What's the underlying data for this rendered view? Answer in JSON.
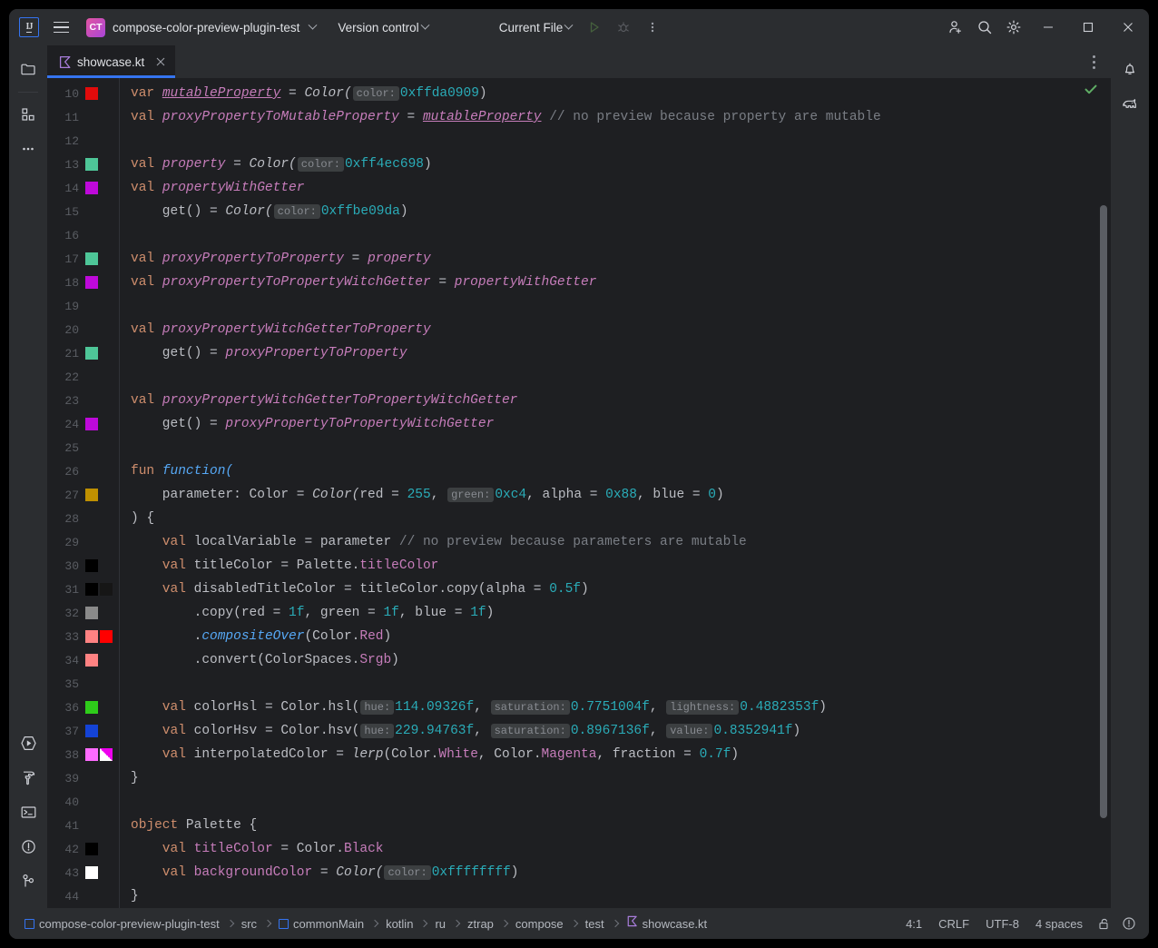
{
  "titlebar": {
    "logo_text": "IJ",
    "menu_icon": "hamburger-menu-icon",
    "project_initials": "CT",
    "project_name": "compose-color-preview-plugin-test",
    "vcs_label": "Version control",
    "run_config_label": "Current File",
    "run_icon": "run-icon",
    "debug_icon": "debug-icon",
    "more_icon": "more-vertical-icon",
    "account_icon": "add-account-icon",
    "search_icon": "search-icon",
    "settings_icon": "gear-icon",
    "minimize_icon": "minimize-icon",
    "maximize_icon": "maximize-icon",
    "close_icon": "close-icon"
  },
  "left_stripe": {
    "top": [
      {
        "name": "project-tool-window",
        "icon": "folder-icon"
      },
      {
        "name": "structure-tool-window",
        "icon": "grid-squares-icon"
      },
      {
        "name": "more-tool-windows",
        "icon": "ellipsis-icon"
      }
    ],
    "bottom": [
      {
        "name": "run-tool-window",
        "icon": "run-hex-icon"
      },
      {
        "name": "build-tool-window",
        "icon": "hammer-icon"
      },
      {
        "name": "terminal-tool-window",
        "icon": "terminal-icon"
      },
      {
        "name": "problems-tool-window",
        "icon": "exclamation-circle-icon"
      },
      {
        "name": "version-control-tool-window",
        "icon": "branch-icon"
      }
    ]
  },
  "right_stripe": [
    {
      "name": "notifications",
      "icon": "bell-icon"
    },
    {
      "name": "database",
      "icon": "elephant-icon"
    }
  ],
  "tabs": {
    "items": [
      {
        "label": "showcase.kt",
        "icon": "kotlin-file-icon",
        "active": true,
        "close_icon": "close-icon"
      }
    ],
    "options_icon": "more-vertical-icon"
  },
  "editor": {
    "inspection_status": "ok-checkmark",
    "caret_position": "4:1",
    "lines": [
      {
        "num": 10,
        "swatches": [
          "#e20b0b"
        ],
        "tokens": [
          {
            "t": "var ",
            "c": "k"
          },
          {
            "t": "mutableProperty",
            "c": "idu"
          },
          {
            "t": " = ",
            "c": "pl"
          },
          {
            "t": "Color(",
            "c": "cls"
          },
          {
            "t": "color:",
            "c": "hint"
          },
          {
            "t": "0xffda0909",
            "c": "num"
          },
          {
            "t": ")",
            "c": "pl"
          }
        ]
      },
      {
        "num": 11,
        "swatches": [],
        "tokens": [
          {
            "t": "val ",
            "c": "k"
          },
          {
            "t": "proxyPropertyToMutableProperty",
            "c": "id"
          },
          {
            "t": " = ",
            "c": "pl"
          },
          {
            "t": "mutableProperty",
            "c": "idu"
          },
          {
            "t": " // no preview because property are mutable",
            "c": "cm"
          }
        ]
      },
      {
        "num": 12,
        "swatches": [],
        "tokens": []
      },
      {
        "num": 13,
        "swatches": [
          "#4ec698"
        ],
        "tokens": [
          {
            "t": "val ",
            "c": "k"
          },
          {
            "t": "property",
            "c": "id"
          },
          {
            "t": " = ",
            "c": "pl"
          },
          {
            "t": "Color(",
            "c": "cls"
          },
          {
            "t": "color:",
            "c": "hint"
          },
          {
            "t": "0xff4ec698",
            "c": "num"
          },
          {
            "t": ")",
            "c": "pl"
          }
        ]
      },
      {
        "num": 14,
        "swatches": [
          "#be09da"
        ],
        "tokens": [
          {
            "t": "val ",
            "c": "k"
          },
          {
            "t": "propertyWithGetter",
            "c": "id"
          }
        ]
      },
      {
        "num": 15,
        "swatches": [],
        "tokens": [
          {
            "t": "    get() = ",
            "c": "pl"
          },
          {
            "t": "Color(",
            "c": "cls"
          },
          {
            "t": "color:",
            "c": "hint"
          },
          {
            "t": "0xffbe09da",
            "c": "num"
          },
          {
            "t": ")",
            "c": "pl"
          }
        ]
      },
      {
        "num": 16,
        "swatches": [],
        "tokens": []
      },
      {
        "num": 17,
        "swatches": [
          "#4ec698"
        ],
        "tokens": [
          {
            "t": "val ",
            "c": "k"
          },
          {
            "t": "proxyPropertyToProperty",
            "c": "id"
          },
          {
            "t": " = ",
            "c": "pl"
          },
          {
            "t": "property",
            "c": "id"
          }
        ]
      },
      {
        "num": 18,
        "swatches": [
          "#be09da"
        ],
        "tokens": [
          {
            "t": "val ",
            "c": "k"
          },
          {
            "t": "proxyPropertyToPropertyWitchGetter",
            "c": "id"
          },
          {
            "t": " = ",
            "c": "pl"
          },
          {
            "t": "propertyWithGetter",
            "c": "id"
          }
        ]
      },
      {
        "num": 19,
        "swatches": [],
        "tokens": []
      },
      {
        "num": 20,
        "swatches": [],
        "tokens": [
          {
            "t": "val ",
            "c": "k"
          },
          {
            "t": "proxyPropertyWitchGetterToProperty",
            "c": "id"
          }
        ]
      },
      {
        "num": 21,
        "swatches": [
          "#4ec698"
        ],
        "tokens": [
          {
            "t": "    get() = ",
            "c": "pl"
          },
          {
            "t": "proxyPropertyToProperty",
            "c": "id"
          }
        ]
      },
      {
        "num": 22,
        "swatches": [],
        "tokens": []
      },
      {
        "num": 23,
        "swatches": [],
        "tokens": [
          {
            "t": "val ",
            "c": "k"
          },
          {
            "t": "proxyPropertyWitchGetterToPropertyWitchGetter",
            "c": "id"
          }
        ]
      },
      {
        "num": 24,
        "swatches": [
          "#be09da"
        ],
        "tokens": [
          {
            "t": "    get() = ",
            "c": "pl"
          },
          {
            "t": "proxyPropertyToPropertyWitchGetter",
            "c": "id"
          }
        ]
      },
      {
        "num": 25,
        "swatches": [],
        "tokens": []
      },
      {
        "num": 26,
        "swatches": [],
        "tokens": [
          {
            "t": "fun ",
            "c": "k"
          },
          {
            "t": "function(",
            "c": "fnb"
          }
        ]
      },
      {
        "num": 27,
        "swatches": [
          "#bf9000"
        ],
        "tokens": [
          {
            "t": "    parameter: Color = ",
            "c": "pl"
          },
          {
            "t": "Color(",
            "c": "cls"
          },
          {
            "t": "red = ",
            "c": "pl"
          },
          {
            "t": "255",
            "c": "num"
          },
          {
            "t": ", ",
            "c": "pl"
          },
          {
            "t": "green:",
            "c": "hint"
          },
          {
            "t": "0xc4",
            "c": "num"
          },
          {
            "t": ", alpha = ",
            "c": "pl"
          },
          {
            "t": "0x88",
            "c": "num"
          },
          {
            "t": ", blue = ",
            "c": "pl"
          },
          {
            "t": "0",
            "c": "num"
          },
          {
            "t": ")",
            "c": "pl"
          }
        ]
      },
      {
        "num": 28,
        "swatches": [],
        "tokens": [
          {
            "t": ") {",
            "c": "pl"
          }
        ]
      },
      {
        "num": 29,
        "swatches": [],
        "tokens": [
          {
            "t": "    val ",
            "c": "k"
          },
          {
            "t": "localVariable = parameter ",
            "c": "pl"
          },
          {
            "t": "// no preview because parameters are mutable",
            "c": "cm"
          }
        ]
      },
      {
        "num": 30,
        "swatches": [
          "#000000"
        ],
        "tokens": [
          {
            "t": "    val ",
            "c": "k"
          },
          {
            "t": "titleColor = Palette.",
            "c": "pl"
          },
          {
            "t": "titleColor",
            "c": "pr"
          }
        ]
      },
      {
        "num": 31,
        "swatches": [
          "#000000",
          "#161616"
        ],
        "tokens": [
          {
            "t": "    val ",
            "c": "k"
          },
          {
            "t": "disabledTitleColor = titleColor.copy(alpha = ",
            "c": "pl"
          },
          {
            "t": "0.5f",
            "c": "num"
          },
          {
            "t": ")",
            "c": "pl"
          }
        ]
      },
      {
        "num": 32,
        "swatches": [
          "#8a8a8a"
        ],
        "tokens": [
          {
            "t": "        .copy(red = ",
            "c": "pl"
          },
          {
            "t": "1f",
            "c": "num"
          },
          {
            "t": ", green = ",
            "c": "pl"
          },
          {
            "t": "1f",
            "c": "num"
          },
          {
            "t": ", blue = ",
            "c": "pl"
          },
          {
            "t": "1f",
            "c": "num"
          },
          {
            "t": ")",
            "c": "pl"
          }
        ]
      },
      {
        "num": 33,
        "swatches": [
          "#ff8282",
          "#ff0000"
        ],
        "tokens": [
          {
            "t": "        .",
            "c": "pl"
          },
          {
            "t": "compositeOver",
            "c": "fnb"
          },
          {
            "t": "(Color.",
            "c": "pl"
          },
          {
            "t": "Red",
            "c": "pr"
          },
          {
            "t": ")",
            "c": "pl"
          }
        ]
      },
      {
        "num": 34,
        "swatches": [
          "#ff8282"
        ],
        "tokens": [
          {
            "t": "        .convert(ColorSpaces.",
            "c": "pl"
          },
          {
            "t": "Srgb",
            "c": "pr"
          },
          {
            "t": ")",
            "c": "pl"
          }
        ]
      },
      {
        "num": 35,
        "swatches": [],
        "tokens": []
      },
      {
        "num": 36,
        "swatches": [
          "#2ecc1a"
        ],
        "tokens": [
          {
            "t": "    val ",
            "c": "k"
          },
          {
            "t": "colorHsl = Color.hsl(",
            "c": "pl"
          },
          {
            "t": "hue:",
            "c": "hint"
          },
          {
            "t": "114.09326f",
            "c": "num"
          },
          {
            "t": ", ",
            "c": "pl"
          },
          {
            "t": "saturation:",
            "c": "hint"
          },
          {
            "t": "0.7751004f",
            "c": "num"
          },
          {
            "t": ", ",
            "c": "pl"
          },
          {
            "t": "lightness:",
            "c": "hint"
          },
          {
            "t": "0.4882353f",
            "c": "num"
          },
          {
            "t": ")",
            "c": "pl"
          }
        ]
      },
      {
        "num": 37,
        "swatches": [
          "#1443d6"
        ],
        "tokens": [
          {
            "t": "    val ",
            "c": "k"
          },
          {
            "t": "colorHsv = Color.hsv(",
            "c": "pl"
          },
          {
            "t": "hue:",
            "c": "hint"
          },
          {
            "t": "229.94763f",
            "c": "num"
          },
          {
            "t": ", ",
            "c": "pl"
          },
          {
            "t": "saturation:",
            "c": "hint"
          },
          {
            "t": "0.8967136f",
            "c": "num"
          },
          {
            "t": ", ",
            "c": "pl"
          },
          {
            "t": "value:",
            "c": "hint"
          },
          {
            "t": "0.8352941f",
            "c": "num"
          },
          {
            "t": ")",
            "c": "pl"
          }
        ]
      },
      {
        "num": 38,
        "swatches": [
          "#ff6bff",
          "half"
        ],
        "tokens": [
          {
            "t": "    val ",
            "c": "k"
          },
          {
            "t": "interpolatedColor = ",
            "c": "pl"
          },
          {
            "t": "lerp",
            "c": "fn"
          },
          {
            "t": "(Color.",
            "c": "pl"
          },
          {
            "t": "White",
            "c": "pr"
          },
          {
            "t": ", Color.",
            "c": "pl"
          },
          {
            "t": "Magenta",
            "c": "pr"
          },
          {
            "t": ", fraction = ",
            "c": "pl"
          },
          {
            "t": "0.7f",
            "c": "num"
          },
          {
            "t": ")",
            "c": "pl"
          }
        ]
      },
      {
        "num": 39,
        "swatches": [],
        "tokens": [
          {
            "t": "}",
            "c": "pl"
          }
        ]
      },
      {
        "num": 40,
        "swatches": [],
        "tokens": []
      },
      {
        "num": 41,
        "swatches": [],
        "tokens": [
          {
            "t": "object ",
            "c": "k"
          },
          {
            "t": "Palette {",
            "c": "pl"
          }
        ]
      },
      {
        "num": 42,
        "swatches": [
          "#000000"
        ],
        "tokens": [
          {
            "t": "    val ",
            "c": "k"
          },
          {
            "t": "titleColor",
            "c": "pr"
          },
          {
            "t": " = Color.",
            "c": "pl"
          },
          {
            "t": "Black",
            "c": "pr"
          }
        ]
      },
      {
        "num": 43,
        "swatches": [
          "#ffffff"
        ],
        "tokens": [
          {
            "t": "    val ",
            "c": "k"
          },
          {
            "t": "backgroundColor",
            "c": "pr"
          },
          {
            "t": " = ",
            "c": "pl"
          },
          {
            "t": "Color(",
            "c": "cls"
          },
          {
            "t": "color:",
            "c": "hint"
          },
          {
            "t": "0xffffffff",
            "c": "num"
          },
          {
            "t": ")",
            "c": "pl"
          }
        ]
      },
      {
        "num": 44,
        "swatches": [],
        "tokens": [
          {
            "t": "}",
            "c": "pl"
          }
        ]
      }
    ]
  },
  "statusbar": {
    "breadcrumbs": [
      {
        "label": "compose-color-preview-plugin-test",
        "icon": "module-icon"
      },
      {
        "label": "src",
        "icon": null
      },
      {
        "label": "commonMain",
        "icon": "module-icon"
      },
      {
        "label": "kotlin",
        "icon": null
      },
      {
        "label": "ru",
        "icon": null
      },
      {
        "label": "ztrap",
        "icon": null
      },
      {
        "label": "compose",
        "icon": null
      },
      {
        "label": "test",
        "icon": null
      },
      {
        "label": "showcase.kt",
        "icon": "kotlin-file-icon"
      }
    ],
    "position": "4:1",
    "line_separator": "CRLF",
    "encoding": "UTF-8",
    "indent": "4 spaces",
    "lock_icon": "unlocked-icon",
    "inspections_icon": "inspections-widget-icon"
  },
  "colors": {
    "accent": "#3574f0",
    "window_bg": "#2b2d30",
    "editor_bg": "#1e1f22",
    "text": "#dfe1e5"
  }
}
